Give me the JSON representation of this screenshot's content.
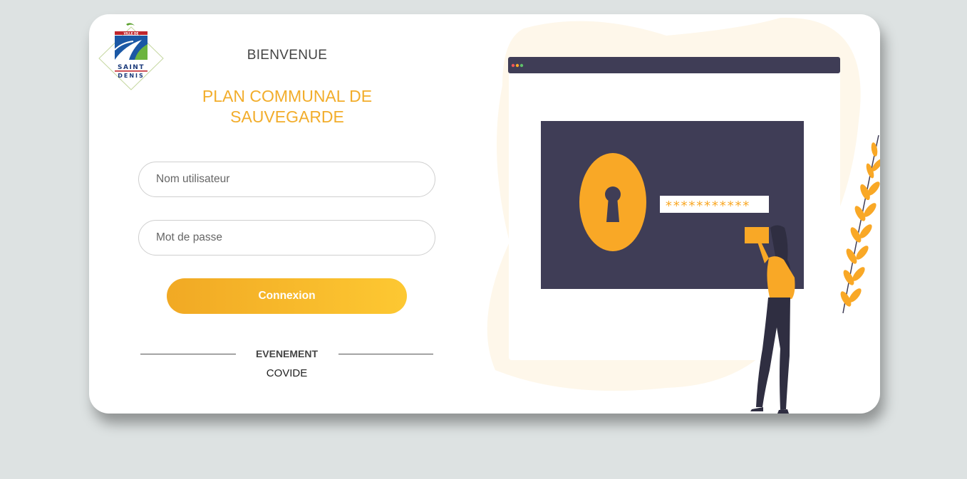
{
  "logo": {
    "top_text": "VILLE DE",
    "line1": "SAINT",
    "line2": "DENIS"
  },
  "welcome": "BIENVENUE",
  "app_title_line1": "PLAN COMMUNAL DE",
  "app_title_line2": "SAUVEGARDE",
  "form": {
    "username_placeholder": "Nom utilisateur",
    "password_placeholder": "Mot de passe",
    "login_label": "Connexion"
  },
  "event": {
    "label": "EVENEMENT",
    "link": "COVIDE"
  },
  "illustration": {
    "password_mask": "***********"
  },
  "colors": {
    "accent": "#f2ad2b",
    "button_start": "#f1a924",
    "button_end": "#fdc832",
    "screen_dark": "#3f3d56",
    "background": "#dde2e2"
  }
}
